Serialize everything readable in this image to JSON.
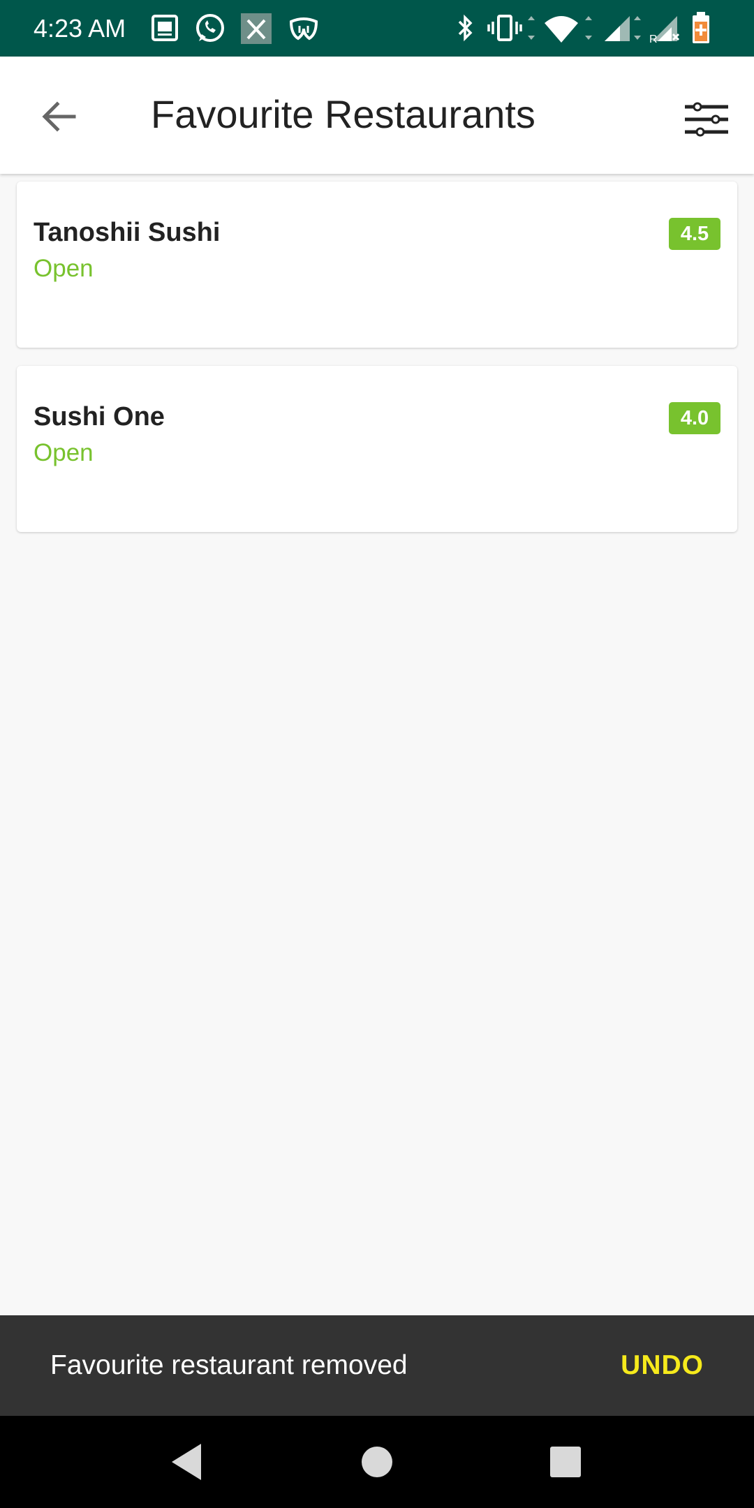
{
  "status_bar": {
    "time": "4:23 AM",
    "left_icons": [
      "photo-icon",
      "whatsapp-icon",
      "notification-x-icon",
      "mask-icon"
    ],
    "right_icons": [
      "bluetooth-icon",
      "vibrate-icon",
      "wifi-icon",
      "signal-icon",
      "signal-roaming-icon",
      "battery-charging-icon"
    ],
    "bar_color": "#00574b",
    "battery_color": "#f28c3a"
  },
  "app_bar": {
    "title": "Favourite Restaurants",
    "back_icon": "arrow-back-icon",
    "filter_icon": "sliders-icon"
  },
  "restaurants": [
    {
      "name": "Tanoshii Sushi",
      "status": "Open",
      "rating": "4.5"
    },
    {
      "name": "Sushi One",
      "status": "Open",
      "rating": "4.0"
    }
  ],
  "colors": {
    "accent_green": "#78c22e",
    "snackbar_bg": "#333333",
    "snackbar_action": "#f6ea1c"
  },
  "snackbar": {
    "message": "Favourite restaurant removed",
    "action": "UNDO"
  },
  "nav_bar": {
    "buttons": [
      "nav-back-icon",
      "nav-home-icon",
      "nav-recents-icon"
    ]
  }
}
